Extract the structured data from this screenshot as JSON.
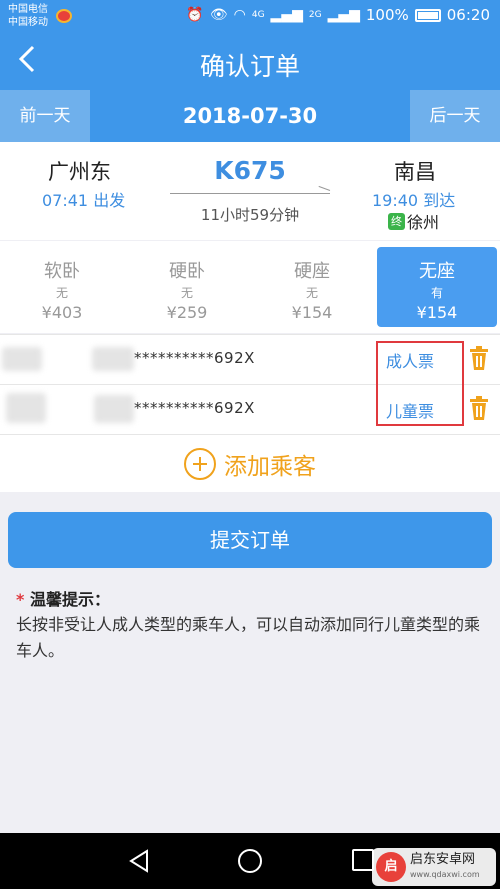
{
  "status_bar": {
    "carrier_1": "中国电信",
    "carrier_2": "中国移动",
    "net_1": "4G",
    "net_2": "2G",
    "battery": "100%",
    "time": "06:20"
  },
  "header": {
    "title": "确认订单",
    "back_icon": "chevron-left-icon"
  },
  "date_bar": {
    "prev_label": "前一天",
    "date": "2018-07-30",
    "next_label": "后一天"
  },
  "train": {
    "from_station": "广州东",
    "from_time": "07:41 出发",
    "number": "K675",
    "duration": "11小时59分钟",
    "to_station": "南昌",
    "to_time": "19:40 到达",
    "terminal_badge": "终",
    "terminal_station": "徐州"
  },
  "seats": [
    {
      "name": "软卧",
      "availability": "无",
      "price": "¥403",
      "selected": false
    },
    {
      "name": "硬卧",
      "availability": "无",
      "price": "¥259",
      "selected": false
    },
    {
      "name": "硬座",
      "availability": "无",
      "price": "¥154",
      "selected": false
    },
    {
      "name": "无座",
      "availability": "有",
      "price": "¥154",
      "selected": true
    }
  ],
  "passengers": [
    {
      "id_number": "**********692X",
      "ticket_type": "成人票"
    },
    {
      "id_number": "**********692X",
      "ticket_type": "儿童票"
    }
  ],
  "add_passenger_label": "添加乘客",
  "submit_label": "提交订单",
  "tips": {
    "star": "*",
    "title": "温馨提示：",
    "body": "长按非受让人成人类型的乘车人，可以自动添加同行儿童类型的乘车人。"
  },
  "watermark": {
    "logo": "启",
    "name": "启东安卓网",
    "url": "www.qdaxwi.com"
  },
  "colors": {
    "primary": "#3e97ea",
    "accent": "#f0a21c",
    "highlight": "#e0393e"
  }
}
